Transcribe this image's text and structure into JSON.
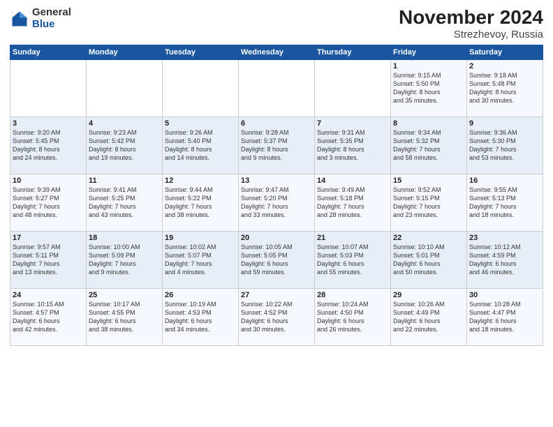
{
  "logo": {
    "general": "General",
    "blue": "Blue"
  },
  "title": "November 2024",
  "subtitle": "Strezhevoy, Russia",
  "days_of_week": [
    "Sunday",
    "Monday",
    "Tuesday",
    "Wednesday",
    "Thursday",
    "Friday",
    "Saturday"
  ],
  "weeks": [
    [
      {
        "day": "",
        "info": ""
      },
      {
        "day": "",
        "info": ""
      },
      {
        "day": "",
        "info": ""
      },
      {
        "day": "",
        "info": ""
      },
      {
        "day": "",
        "info": ""
      },
      {
        "day": "1",
        "info": "Sunrise: 9:15 AM\nSunset: 5:50 PM\nDaylight: 8 hours\nand 35 minutes."
      },
      {
        "day": "2",
        "info": "Sunrise: 9:18 AM\nSunset: 5:48 PM\nDaylight: 8 hours\nand 30 minutes."
      }
    ],
    [
      {
        "day": "3",
        "info": "Sunrise: 9:20 AM\nSunset: 5:45 PM\nDaylight: 8 hours\nand 24 minutes."
      },
      {
        "day": "4",
        "info": "Sunrise: 9:23 AM\nSunset: 5:42 PM\nDaylight: 8 hours\nand 19 minutes."
      },
      {
        "day": "5",
        "info": "Sunrise: 9:26 AM\nSunset: 5:40 PM\nDaylight: 8 hours\nand 14 minutes."
      },
      {
        "day": "6",
        "info": "Sunrise: 9:28 AM\nSunset: 5:37 PM\nDaylight: 8 hours\nand 9 minutes."
      },
      {
        "day": "7",
        "info": "Sunrise: 9:31 AM\nSunset: 5:35 PM\nDaylight: 8 hours\nand 3 minutes."
      },
      {
        "day": "8",
        "info": "Sunrise: 9:34 AM\nSunset: 5:32 PM\nDaylight: 7 hours\nand 58 minutes."
      },
      {
        "day": "9",
        "info": "Sunrise: 9:36 AM\nSunset: 5:30 PM\nDaylight: 7 hours\nand 53 minutes."
      }
    ],
    [
      {
        "day": "10",
        "info": "Sunrise: 9:39 AM\nSunset: 5:27 PM\nDaylight: 7 hours\nand 48 minutes."
      },
      {
        "day": "11",
        "info": "Sunrise: 9:41 AM\nSunset: 5:25 PM\nDaylight: 7 hours\nand 43 minutes."
      },
      {
        "day": "12",
        "info": "Sunrise: 9:44 AM\nSunset: 5:22 PM\nDaylight: 7 hours\nand 38 minutes."
      },
      {
        "day": "13",
        "info": "Sunrise: 9:47 AM\nSunset: 5:20 PM\nDaylight: 7 hours\nand 33 minutes."
      },
      {
        "day": "14",
        "info": "Sunrise: 9:49 AM\nSunset: 5:18 PM\nDaylight: 7 hours\nand 28 minutes."
      },
      {
        "day": "15",
        "info": "Sunrise: 9:52 AM\nSunset: 5:15 PM\nDaylight: 7 hours\nand 23 minutes."
      },
      {
        "day": "16",
        "info": "Sunrise: 9:55 AM\nSunset: 5:13 PM\nDaylight: 7 hours\nand 18 minutes."
      }
    ],
    [
      {
        "day": "17",
        "info": "Sunrise: 9:57 AM\nSunset: 5:11 PM\nDaylight: 7 hours\nand 13 minutes."
      },
      {
        "day": "18",
        "info": "Sunrise: 10:00 AM\nSunset: 5:09 PM\nDaylight: 7 hours\nand 9 minutes."
      },
      {
        "day": "19",
        "info": "Sunrise: 10:02 AM\nSunset: 5:07 PM\nDaylight: 7 hours\nand 4 minutes."
      },
      {
        "day": "20",
        "info": "Sunrise: 10:05 AM\nSunset: 5:05 PM\nDaylight: 6 hours\nand 59 minutes."
      },
      {
        "day": "21",
        "info": "Sunrise: 10:07 AM\nSunset: 5:03 PM\nDaylight: 6 hours\nand 55 minutes."
      },
      {
        "day": "22",
        "info": "Sunrise: 10:10 AM\nSunset: 5:01 PM\nDaylight: 6 hours\nand 50 minutes."
      },
      {
        "day": "23",
        "info": "Sunrise: 10:12 AM\nSunset: 4:59 PM\nDaylight: 6 hours\nand 46 minutes."
      }
    ],
    [
      {
        "day": "24",
        "info": "Sunrise: 10:15 AM\nSunset: 4:57 PM\nDaylight: 6 hours\nand 42 minutes."
      },
      {
        "day": "25",
        "info": "Sunrise: 10:17 AM\nSunset: 4:55 PM\nDaylight: 6 hours\nand 38 minutes."
      },
      {
        "day": "26",
        "info": "Sunrise: 10:19 AM\nSunset: 4:53 PM\nDaylight: 6 hours\nand 34 minutes."
      },
      {
        "day": "27",
        "info": "Sunrise: 10:22 AM\nSunset: 4:52 PM\nDaylight: 6 hours\nand 30 minutes."
      },
      {
        "day": "28",
        "info": "Sunrise: 10:24 AM\nSunset: 4:50 PM\nDaylight: 6 hours\nand 26 minutes."
      },
      {
        "day": "29",
        "info": "Sunrise: 10:26 AM\nSunset: 4:49 PM\nDaylight: 6 hours\nand 22 minutes."
      },
      {
        "day": "30",
        "info": "Sunrise: 10:28 AM\nSunset: 4:47 PM\nDaylight: 6 hours\nand 18 minutes."
      }
    ]
  ]
}
